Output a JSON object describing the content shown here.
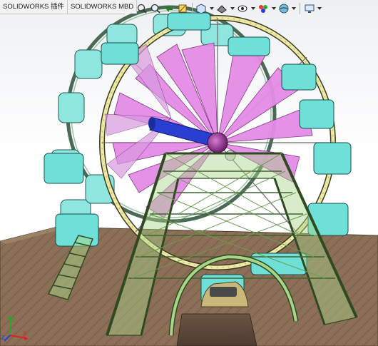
{
  "tabs": [
    {
      "label": "SOLIDWORKS 插件"
    },
    {
      "label": "SOLIDWORKS MBD"
    }
  ],
  "toolbar": {
    "icons": [
      "zoom-to-fit-icon",
      "zoom-area-icon",
      "previous-view-icon",
      "section-view-icon",
      "view-orientation-icon",
      "display-style-icon",
      "hide-show-items-icon",
      "appearance-icon",
      "scene-icon",
      "view-settings-icon"
    ]
  },
  "model": {
    "description_icon": "ferris-wheel-assembly",
    "colors": {
      "frame_green": "#a9d58a",
      "frame_outline": "#2f4a22",
      "cabin_cyan": "#6fe0d8",
      "petal_pink": "#e48ce6",
      "rim_yellow": "#efe9a6",
      "axle_blue": "#2a3fd1",
      "hub_purple": "#8a2a8a",
      "ground_brown": "#8a6e55"
    }
  },
  "triad": {
    "axis_x": "X",
    "axis_y": "Y",
    "axis_z": "Z"
  }
}
